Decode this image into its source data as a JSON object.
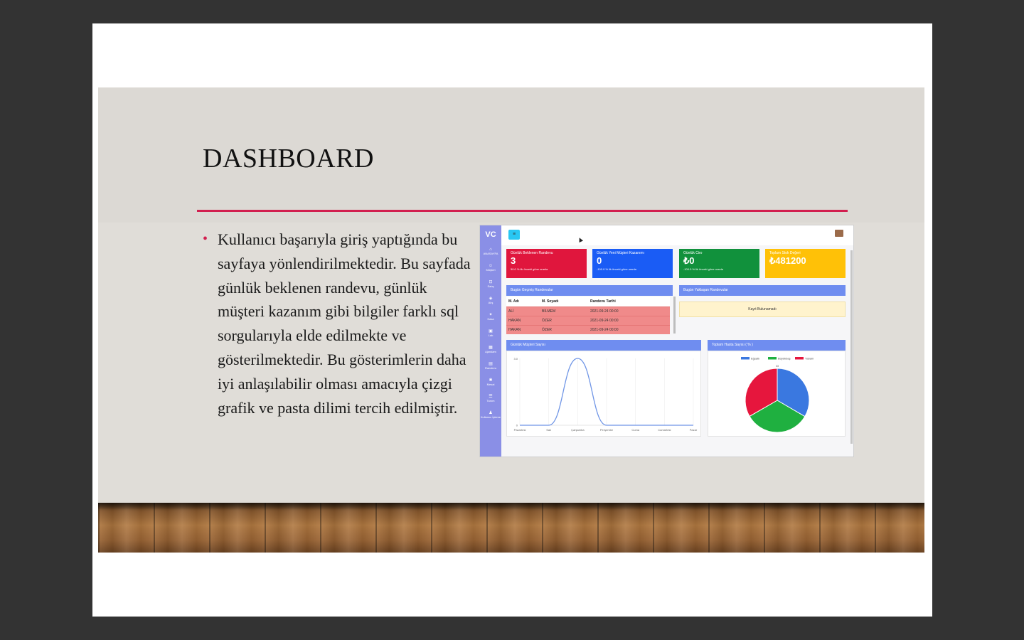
{
  "slide": {
    "title": "DASHBOARD",
    "bullet": "Kullanıcı başarıyla giriş yaptığında bu sayfaya yönlendirilmektedir. Bu sayfada günlük beklenen randevu, günlük müşteri kazanım gibi bilgiler farklı sql sorgularıyla elde edilmekte ve gösterilmektedir. Bu gösterimlerin daha iyi anlaşılabilir olması amacıyla çizgi grafik ve pasta dilimi tercih edilmiştir.",
    "accent_color": "#d21f4f"
  },
  "dashboard": {
    "logo": "VC",
    "sidebar_items": [
      {
        "icon": "home-icon",
        "label": "ANASAYFA"
      },
      {
        "icon": "users-icon",
        "label": "Müşteri"
      },
      {
        "icon": "cart-icon",
        "label": "Satış"
      },
      {
        "icon": "tag-icon",
        "label": "Alış"
      },
      {
        "icon": "cash-icon",
        "label": "Kasa"
      },
      {
        "icon": "box-icon",
        "label": "Lab"
      },
      {
        "icon": "calendar-icon",
        "label": "Ajandam"
      },
      {
        "icon": "calendar-check-icon",
        "label": "Randevu"
      },
      {
        "icon": "gear-icon",
        "label": "Mesai"
      },
      {
        "icon": "list-icon",
        "label": "Tanım"
      },
      {
        "icon": "user-gear-icon",
        "label": "Kullanıcı İşleme"
      }
    ],
    "cards": [
      {
        "label": "Günlük Beklenen Randevu",
        "value": "3",
        "note": "50.0 % lik önceki güne oranla",
        "color": "#e0163d"
      },
      {
        "label": "Günlük Yeni Müşteri Kazanımı",
        "value": "0",
        "note": "-100.0 % lik önceki güne oranla",
        "color": "#1a5cf5"
      },
      {
        "label": "Günlük Ciro",
        "value": "₺0",
        "note": "-100.0 % lik önceki güne oranla",
        "color": "#11913c"
      },
      {
        "label": "Toplam Stok Değeri",
        "value": "₺481200",
        "note": "",
        "color": "#ffc107"
      }
    ],
    "past_appointments": {
      "title": "Bugün Geçmiş Randevular",
      "columns": [
        "M. Adı",
        "M. Soyadı",
        "Randevu Tarihi"
      ],
      "rows": [
        [
          "ALİ",
          "BİLMEM",
          "2021-09-24 00:00"
        ],
        [
          "HAKAN",
          "ÖZER",
          "2021-09-24 00:00"
        ],
        [
          "HAKAN",
          "ÖZER",
          "2021-09-24 00:00"
        ]
      ]
    },
    "upcoming": {
      "title": "Bugün Yaklaşan Randevular",
      "empty_text": "Kayıt Bulunamadı"
    },
    "line_chart_title": "Günlük Müşteri Sayısı",
    "pie_chart_title": "Toplam Hasta Sayısı ( % )"
  },
  "chart_data": [
    {
      "type": "line",
      "title": "Günlük Müşteri Sayısı",
      "categories": [
        "Pazartesi",
        "Salı",
        "Çarşamba",
        "Perşembe",
        "Cuma",
        "Cumartesi",
        "Pazar"
      ],
      "series": [
        {
          "values": [
            0,
            0,
            3,
            0,
            0,
            0,
            0
          ],
          "color": "#6f95e6"
        }
      ],
      "ylim": [
        0,
        3
      ],
      "yticks": [
        "3.0",
        "0"
      ],
      "grid": true
    },
    {
      "type": "pie",
      "title": "Toplam Hasta Sayısı ( % )",
      "legend_position": "top",
      "series": [
        {
          "name": "Eğsatlı",
          "value": 33.4,
          "color": "#3a78e0"
        },
        {
          "name": "Büyükbaş",
          "value": 33.3,
          "color": "#1fb040"
        },
        {
          "name": "Yabani",
          "value": 33.3,
          "color": "#e6163d"
        }
      ],
      "slice_label": "33"
    }
  ]
}
